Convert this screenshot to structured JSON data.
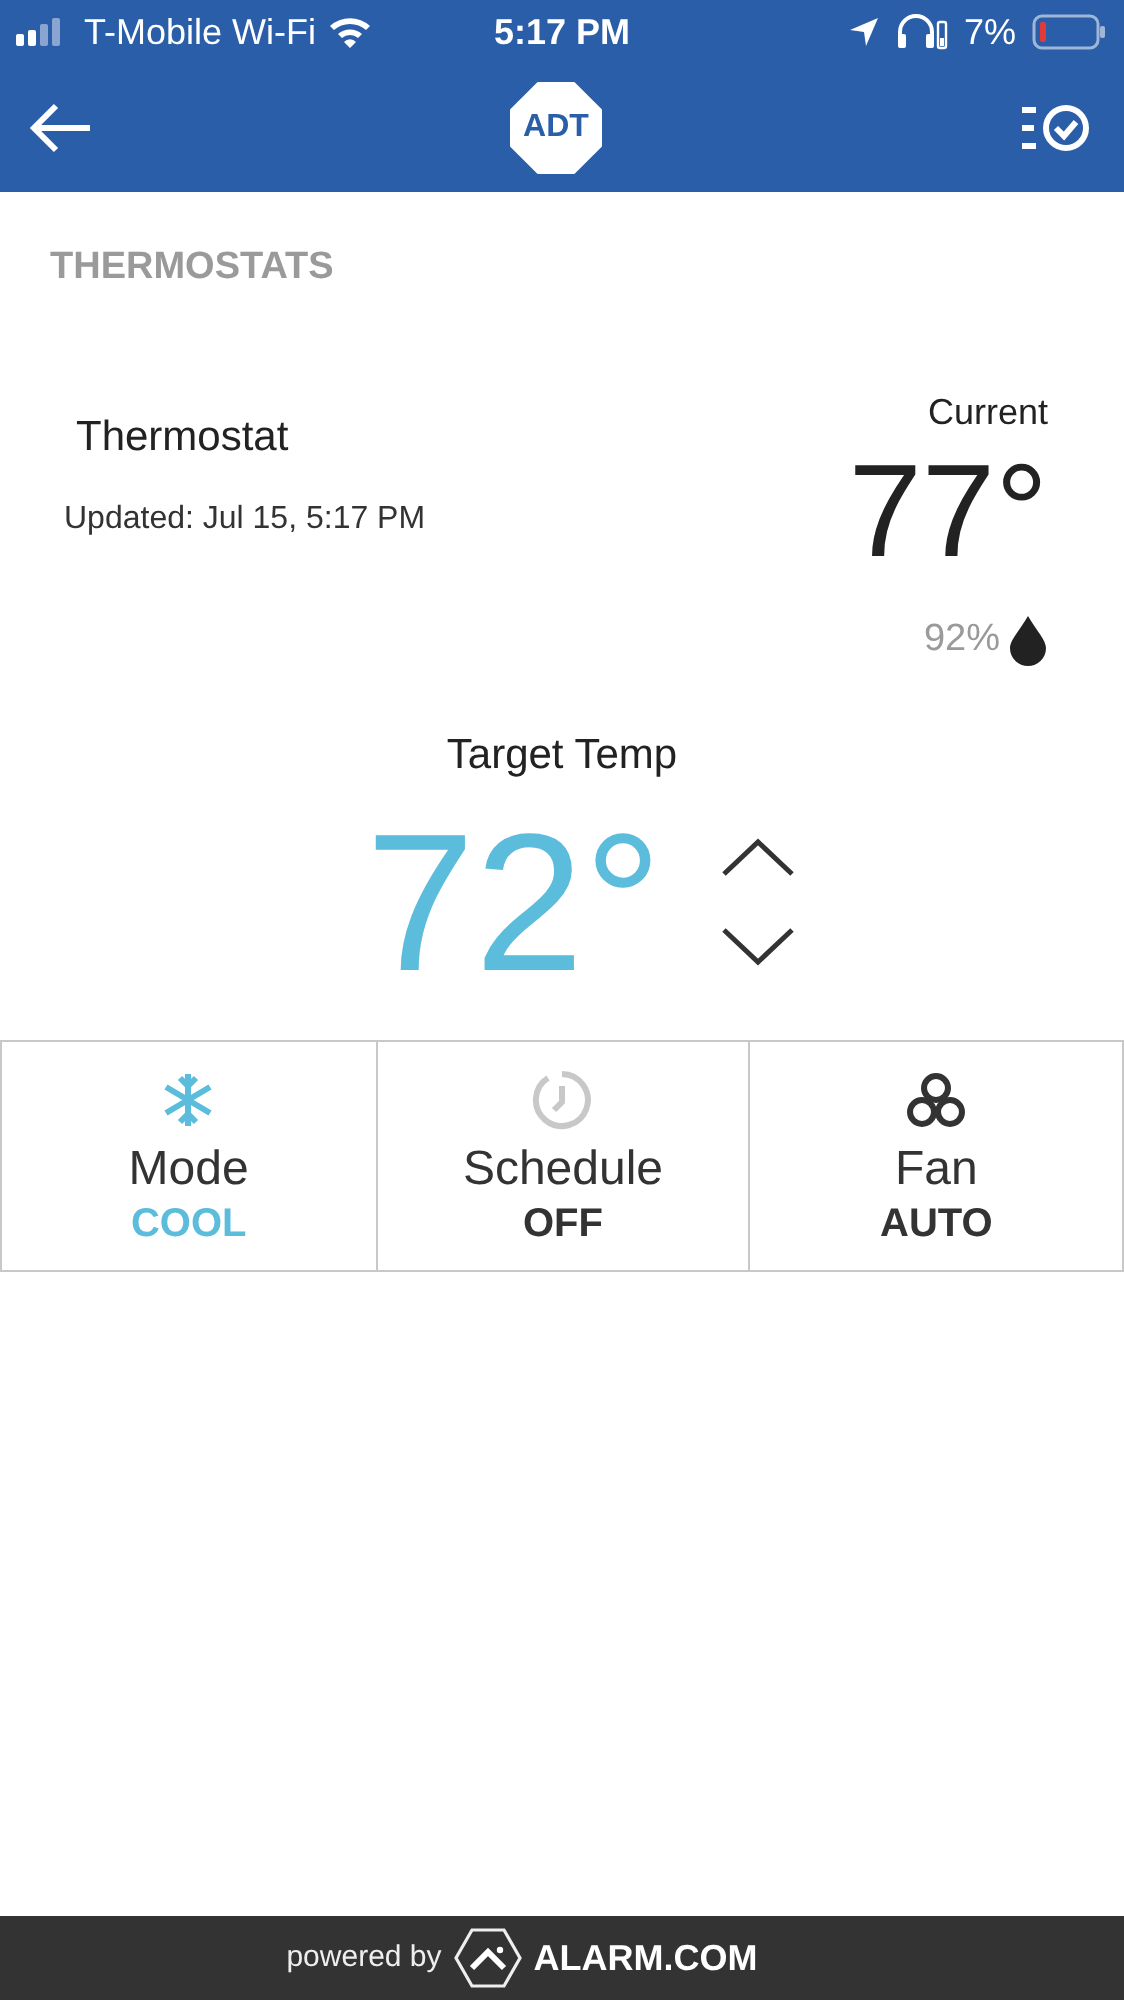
{
  "status_bar": {
    "carrier": "T-Mobile Wi-Fi",
    "time": "5:17 PM",
    "battery": "7%"
  },
  "header": {
    "logo": "ADT"
  },
  "section_title": "THERMOSTATS",
  "thermostat": {
    "name": "Thermostat",
    "updated": "Updated: Jul 15, 5:17 PM",
    "current_label": "Current",
    "current_temp": "77°",
    "humidity": "92%"
  },
  "target": {
    "label": "Target Temp",
    "temp": "72°"
  },
  "tiles": [
    {
      "kind": "mode",
      "label": "Mode",
      "value": "COOL"
    },
    {
      "kind": "schedule",
      "label": "Schedule",
      "value": "OFF"
    },
    {
      "kind": "fan",
      "label": "Fan",
      "value": "AUTO"
    }
  ],
  "footer": {
    "powered_by": "powered by",
    "brand": "ALARM.COM"
  }
}
